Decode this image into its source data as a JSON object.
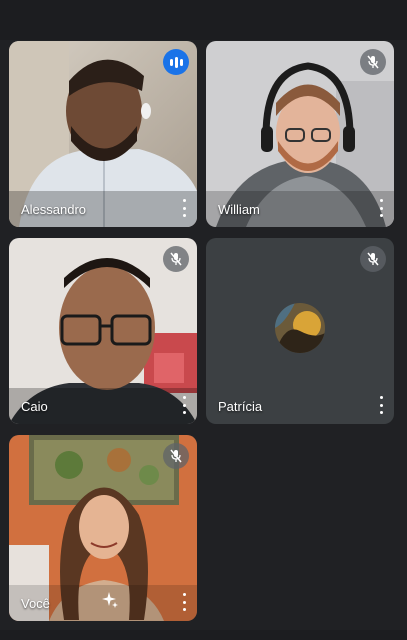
{
  "participants": [
    {
      "name": "Alessandro",
      "status_icon": "speaking-indicator-icon",
      "accent": "#1a73e8"
    },
    {
      "name": "William",
      "status_icon": "mic-off-icon"
    },
    {
      "name": "Caio",
      "status_icon": "mic-off-icon"
    },
    {
      "name": "Patrícia",
      "status_icon": "mic-off-icon",
      "avatar_icon": "avatar"
    },
    {
      "name": "Você",
      "status_icon": "mic-off-icon",
      "extra_icon": "visual-effects-icon"
    }
  ],
  "colors": {
    "background": "#202124",
    "tile_empty": "#3c4043",
    "speaking": "#1a73e8"
  }
}
